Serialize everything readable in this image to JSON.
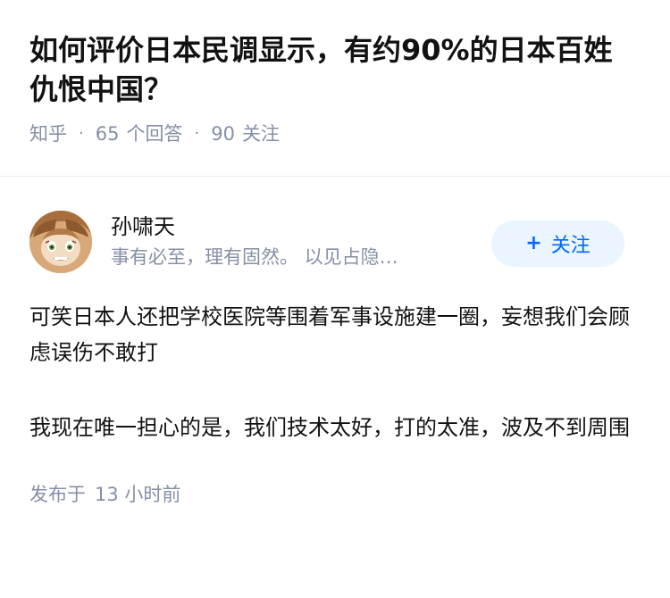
{
  "question": {
    "title": "如何评价日本民调显示，有约90%的日本百姓仇恨中国？",
    "source": "知乎",
    "answer_count": "65",
    "answer_label": "个回答",
    "follow_count": "90",
    "follow_label": "关注"
  },
  "answer": {
    "author": {
      "name": "孙啸天",
      "bio": "事有必至，理有固然。 以见占隐…",
      "follow_button_label": "关注"
    },
    "paragraphs": [
      "可笑日本人还把学校医院等围着军事设施建一圈，妄想我们会顾虑误伤不敢打",
      "我现在唯一担心的是，我们技术太好，打的太准，波及不到周围"
    ],
    "published_prefix": "发布于",
    "published_time": "13 小时前"
  },
  "colors": {
    "meta_gray": "#8590a6",
    "follow_blue": "#0066ff",
    "follow_bg": "#ebf5ff"
  },
  "icons": [
    "plus-icon",
    "avatar-image"
  ]
}
